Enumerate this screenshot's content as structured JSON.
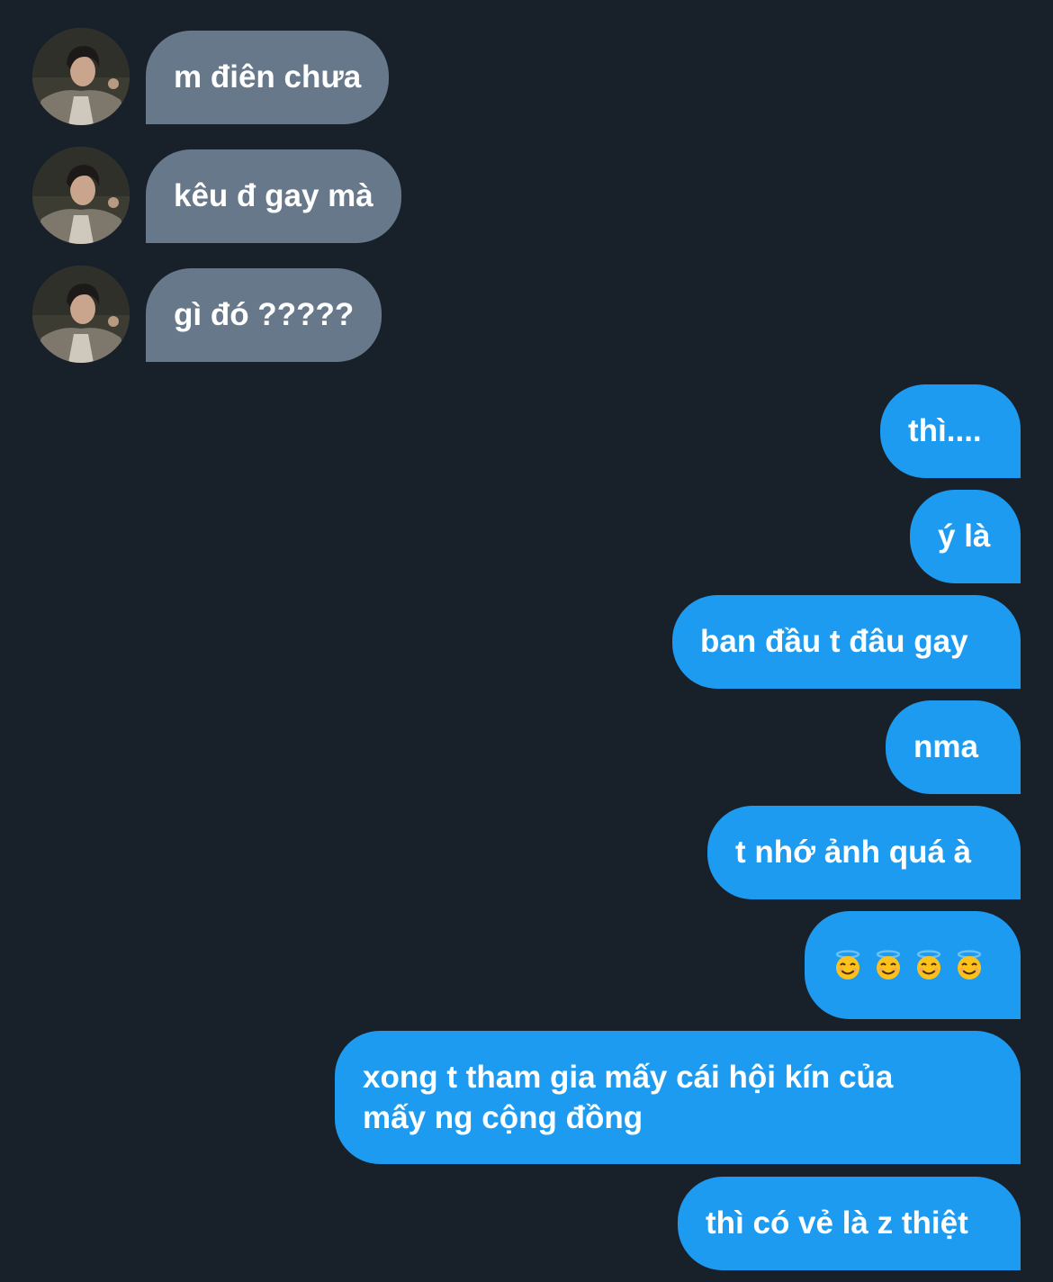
{
  "incoming": [
    {
      "text": "m điên chưa"
    },
    {
      "text": "kêu đ gay mà"
    },
    {
      "text": "gì đó ?????"
    }
  ],
  "outgoing": [
    {
      "text": "thì...."
    },
    {
      "text": "ý là"
    },
    {
      "text": "ban đầu t đâu gay"
    },
    {
      "text": "nma"
    },
    {
      "text": "t nhớ ảnh quá à"
    },
    {
      "emoji": [
        "smiling-face-with-halo",
        "smiling-face-with-halo",
        "smiling-face-with-halo",
        "smiling-face-with-halo"
      ]
    },
    {
      "text": "xong t tham gia mấy cái hội kín của mấy ng cộng đồng"
    },
    {
      "text": "thì có vẻ là z thiệt"
    }
  ],
  "colors": {
    "background": "#18202a",
    "incoming_bubble": "#66788a",
    "outgoing_bubble": "#1d9bf0",
    "text": "#ffffff"
  }
}
